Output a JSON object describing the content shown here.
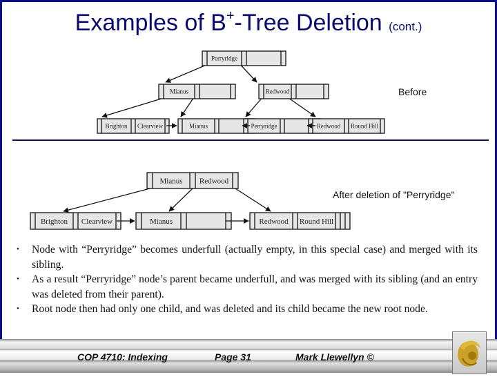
{
  "title": {
    "main": "Examples of B",
    "sup": "+",
    "rest": "-Tree Deletion",
    "cont": "(cont.)"
  },
  "labels": {
    "before": "Before",
    "after": "After deletion of \"Perryridge\""
  },
  "before_tree": {
    "root": [
      "Perryridge"
    ],
    "internal": [
      [
        "Mianus"
      ],
      [
        "Redwood"
      ]
    ],
    "leaves": [
      [
        "Brighton",
        "Clearview"
      ],
      [
        "Mianus"
      ],
      [
        "Perryridge"
      ],
      [
        "Redwood",
        "Round Hill"
      ]
    ]
  },
  "after_tree": {
    "root": [
      "Mianus",
      "Redwood"
    ],
    "leaves": [
      [
        "Brighton",
        "Clearview"
      ],
      [
        "Mianus"
      ],
      [
        "Redwood",
        "Round Hill"
      ]
    ]
  },
  "bullets": [
    "Node with “Perryridge” becomes underfull (actually empty, in this special case) and merged with its sibling.",
    "As a result “Perryridge” node’s parent became underfull, and was merged with its sibling (and an entry was deleted from their parent).",
    "Root node then had only one child, and was deleted and its child became the new root node."
  ],
  "bullet_glyph": "•",
  "footer": {
    "course": "COP 4710: Indexing",
    "page": "Page 31",
    "author": "Mark Llewellyn ©"
  },
  "icons": {
    "logo": "ucf-pegasus-logo"
  },
  "colors": {
    "title": "#0a0a6e",
    "frame": "#0a0a8c",
    "logo_gold": "#c9a227"
  }
}
